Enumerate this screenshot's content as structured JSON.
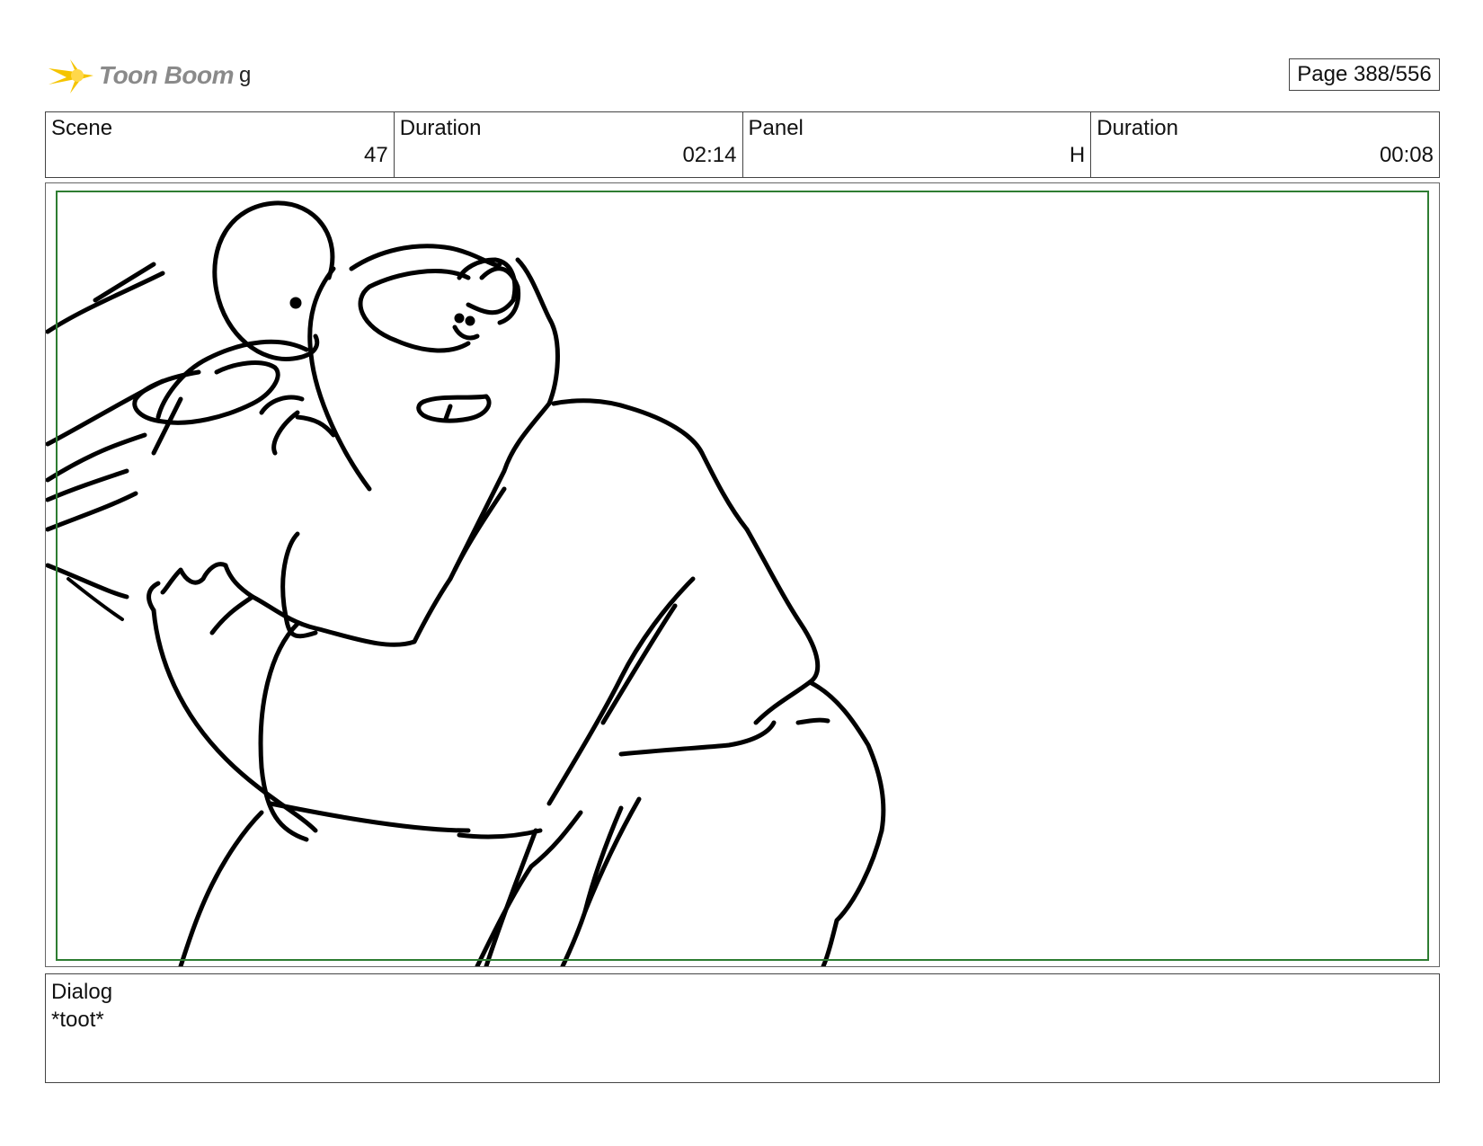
{
  "header": {
    "logo_text": "Toon Boom",
    "project_name": "g",
    "page_label": "Page 388/556"
  },
  "info": {
    "scene_label": "Scene",
    "scene_value": "47",
    "scene_duration_label": "Duration",
    "scene_duration_value": "02:14",
    "panel_label": "Panel",
    "panel_value": "H",
    "panel_duration_label": "Duration",
    "panel_duration_value": "00:08"
  },
  "dialog": {
    "label": "Dialog",
    "text": "*toot*"
  },
  "colors": {
    "safe_frame": "#2e7d32",
    "logo_flash": "#f5c400",
    "logo_text": "#8a8a8a"
  }
}
